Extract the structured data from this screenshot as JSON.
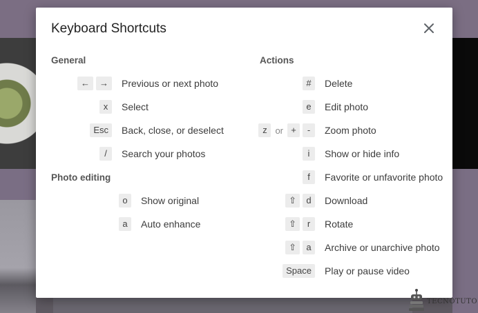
{
  "dialog": {
    "title": "Keyboard Shortcuts",
    "close_icon": "close-icon"
  },
  "general": {
    "heading": "General",
    "items": [
      {
        "keys": [
          "←",
          "→"
        ],
        "label": "Previous or next photo"
      },
      {
        "keys": [
          "x"
        ],
        "label": "Select"
      },
      {
        "keys": [
          "Esc"
        ],
        "label": "Back, close, or deselect"
      },
      {
        "keys": [
          "/"
        ],
        "label": "Search your photos"
      }
    ]
  },
  "photo_editing": {
    "heading": "Photo editing",
    "items": [
      {
        "keys": [
          "o"
        ],
        "label": "Show original"
      },
      {
        "keys": [
          "a"
        ],
        "label": "Auto enhance"
      }
    ]
  },
  "actions": {
    "heading": "Actions",
    "items": [
      {
        "keys": [
          "#"
        ],
        "label": "Delete"
      },
      {
        "keys": [
          "e"
        ],
        "label": "Edit photo"
      },
      {
        "keys": [
          "z",
          "+",
          "-"
        ],
        "separator": "or",
        "label": "Zoom photo"
      },
      {
        "keys": [
          "i"
        ],
        "label": "Show or hide info"
      },
      {
        "keys": [
          "f"
        ],
        "label": "Favorite or unfavorite photo"
      },
      {
        "keys": [
          "⇧",
          "d"
        ],
        "label": "Download"
      },
      {
        "keys": [
          "⇧",
          "r"
        ],
        "label": "Rotate"
      },
      {
        "keys": [
          "⇧",
          "a"
        ],
        "label": "Archive or unarchive photo"
      },
      {
        "keys": [
          "Space"
        ],
        "label": "Play or pause video"
      }
    ]
  },
  "watermark": {
    "text": "TECNOTUTO",
    "icon": "robot-stack-logo-icon"
  }
}
